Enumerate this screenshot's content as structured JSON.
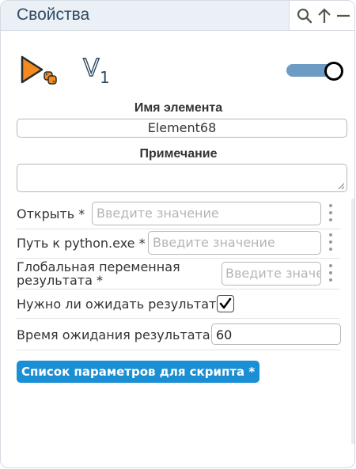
{
  "header": {
    "title": "Свойства",
    "icons": [
      "search-icon",
      "arrow-up-icon",
      "minimize-icon"
    ]
  },
  "element_icons": {
    "type_icon": "python-play-icon",
    "version_icon": "version-icon",
    "version_letter": "V",
    "version_number": "1"
  },
  "toggle": {
    "on": true,
    "accent": "#6c9cc4"
  },
  "name": {
    "label": "Имя элемента",
    "value": "Element68"
  },
  "note": {
    "label": "Примечание",
    "value": ""
  },
  "fields": {
    "open": {
      "label": "Открыть *",
      "placeholder": "Введите значение"
    },
    "python_path": {
      "label": "Путь к python.exe *",
      "placeholder": "Введите значение"
    },
    "global_var": {
      "label_line1": "Глобальная переменная",
      "label_line2": "результата *",
      "placeholder": "Введите значе"
    },
    "wait_result": {
      "label": "Нужно ли ожидать результат",
      "checked": true
    },
    "wait_time": {
      "label": "Время ожидания результата",
      "value": "60"
    }
  },
  "params_button": {
    "label": "Список параметров для скрипта *",
    "color": "#1b8fd4"
  }
}
